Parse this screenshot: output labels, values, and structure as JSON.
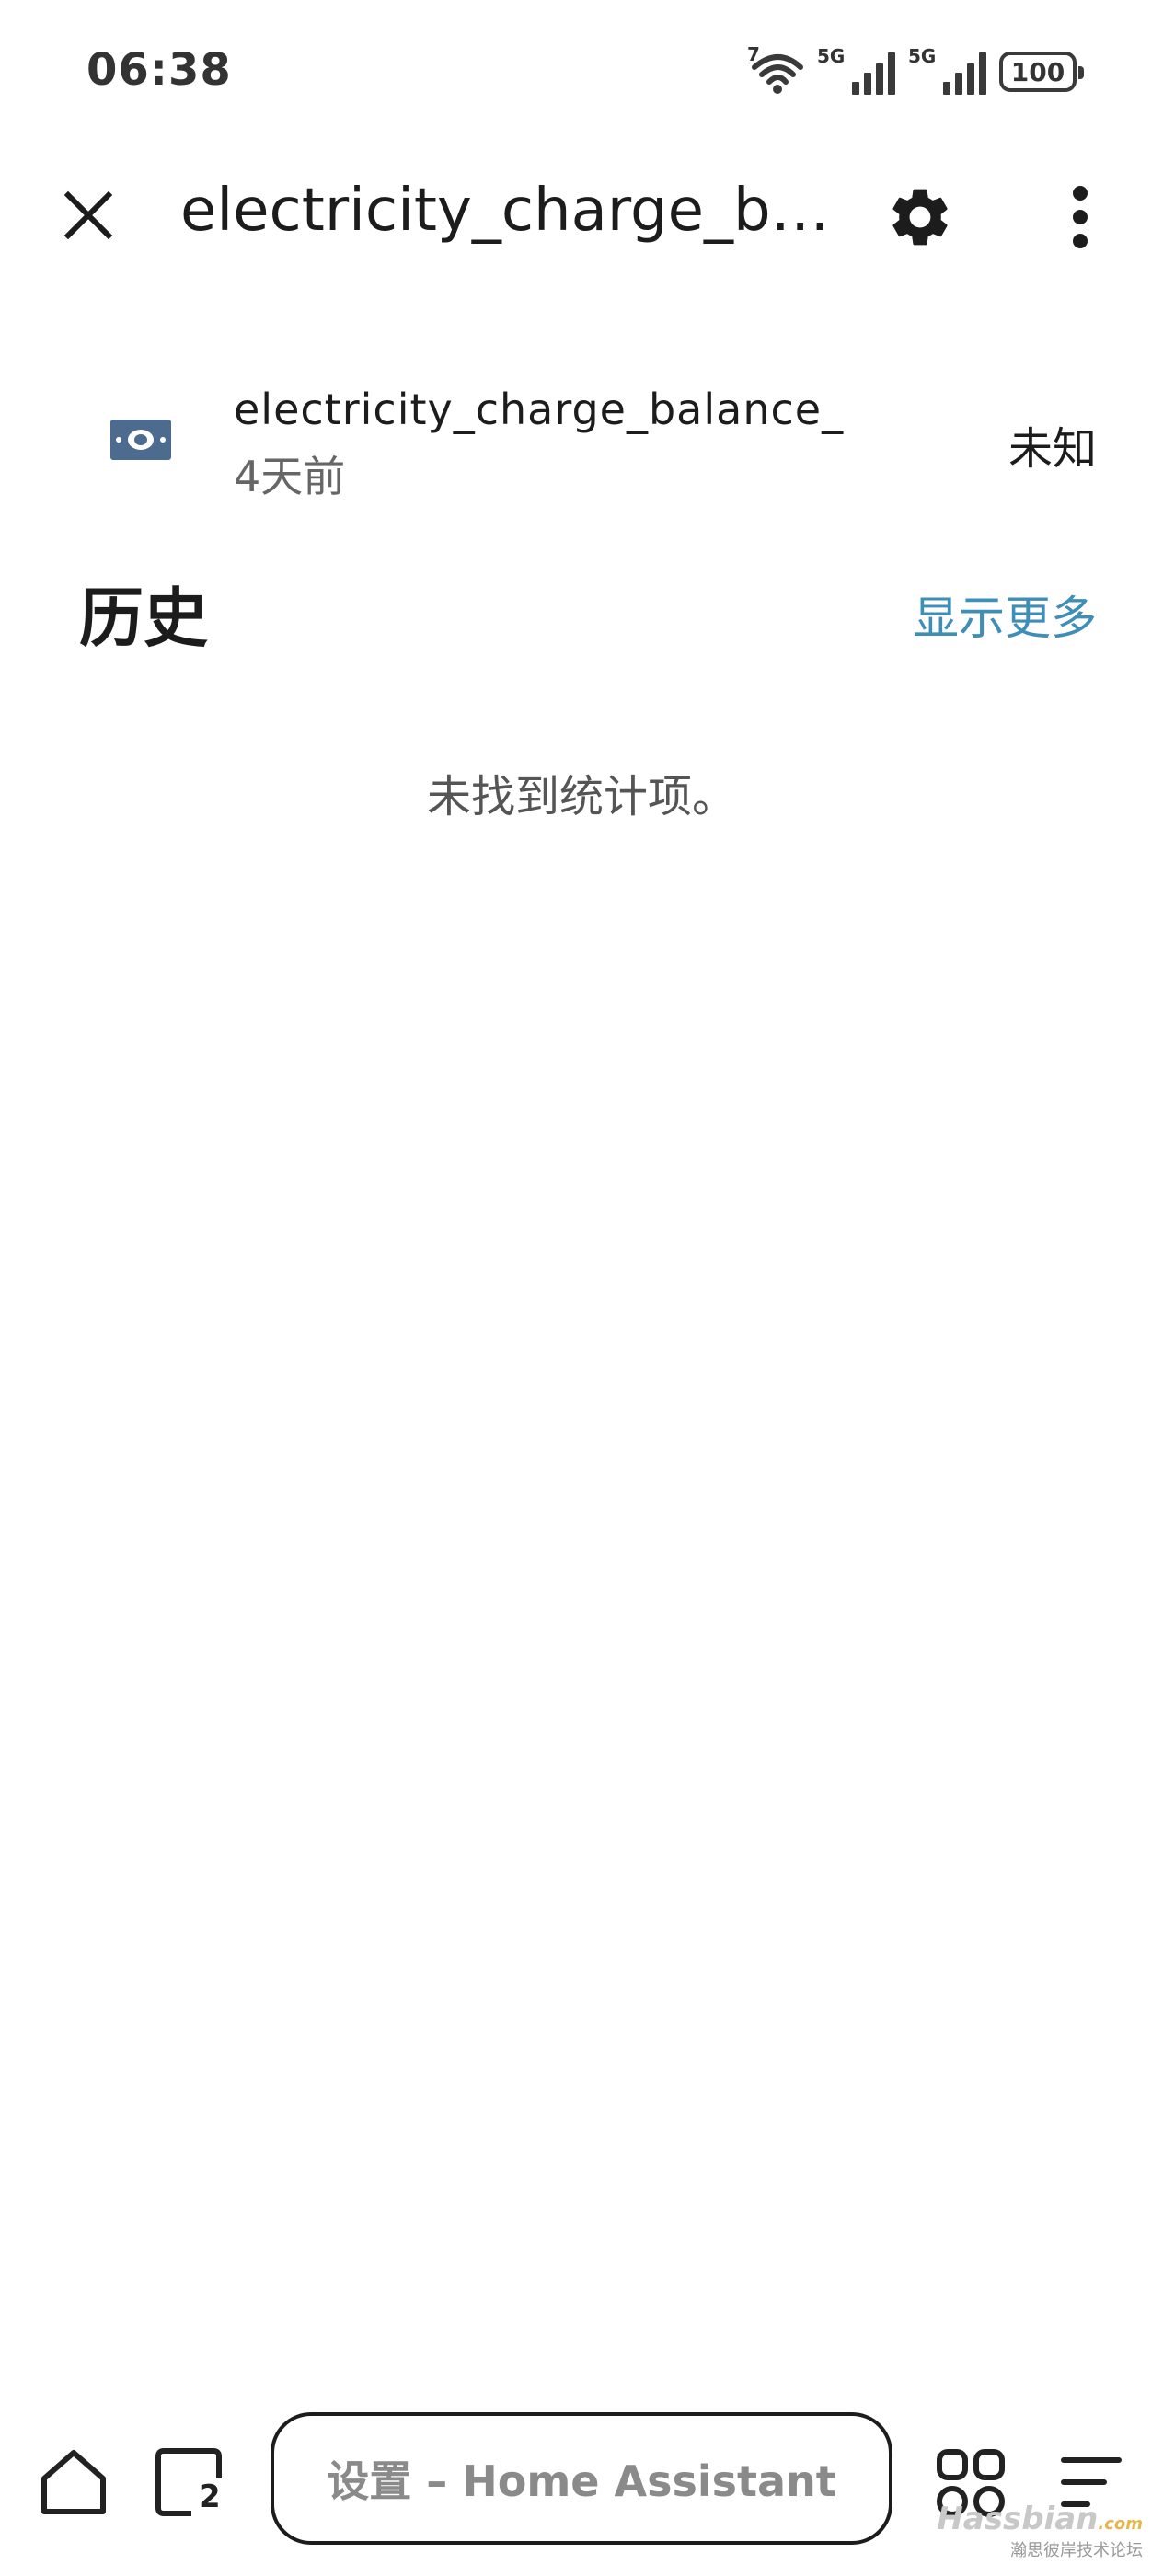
{
  "status_bar": {
    "time": "06:38",
    "wifi_tag": "7",
    "sim1_tag": "5G",
    "sim2_tag": "5G",
    "battery": "100"
  },
  "app_bar": {
    "title": "electricity_charge_balance_",
    "icons": {
      "close": "close-icon",
      "settings": "gear-icon",
      "more": "more-vert-icon"
    }
  },
  "entity": {
    "icon": "cash-icon",
    "icon_color": "#4d6a8f",
    "name": "electricity_charge_balance_",
    "last_changed": "4天前",
    "state": "未知"
  },
  "history": {
    "title": "历史",
    "show_more": "显示更多",
    "empty_message": "未找到统计项。",
    "link_color": "#3e8fb7"
  },
  "browser_bar": {
    "tab_count": "2",
    "page_title": "设置 – Home Assistant",
    "icons": {
      "home": "home-icon",
      "tabs": "tabs-icon",
      "apps": "apps-grid-icon",
      "menu": "menu-lines-icon"
    }
  },
  "watermark": {
    "main": "Hassbian",
    "suffix": ".com",
    "sub": "瀚思彼岸技术论坛"
  }
}
